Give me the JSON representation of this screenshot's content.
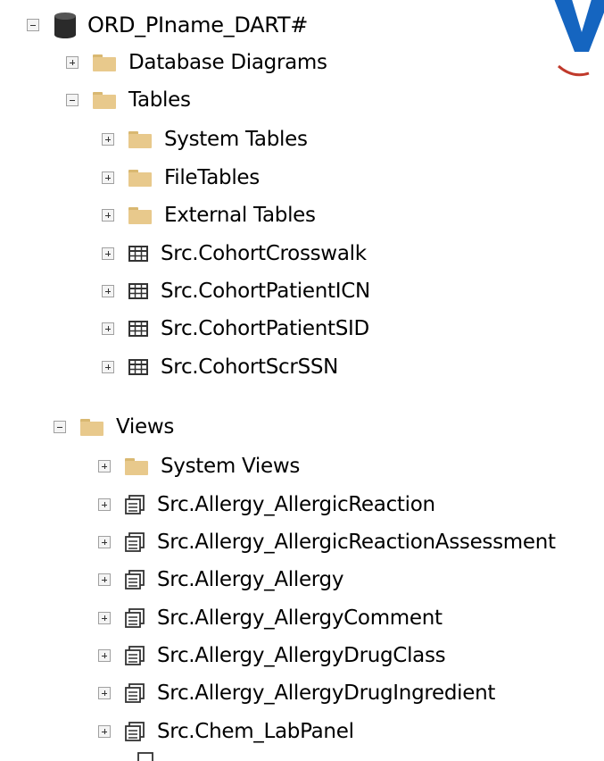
{
  "database": {
    "label": "ORD_PIname_DART#",
    "icon": "database-cylinder-icon"
  },
  "folders": {
    "database_diagrams": "Database Diagrams",
    "tables": "Tables",
    "views": "Views"
  },
  "tables": {
    "system_tables": "System Tables",
    "file_tables": "FileTables",
    "external_tables": "External Tables",
    "items": [
      "Src.CohortCrosswalk",
      "Src.CohortPatientICN",
      "Src.CohortPatientSID",
      "Src.CohortScrSSN"
    ]
  },
  "views": {
    "system_views": "System Views",
    "items": [
      "Src.Allergy_AllergicReaction",
      "Src.Allergy_AllergicReactionAssessment",
      "Src.Allergy_Allergy",
      "Src.Allergy_AllergyComment",
      "Src.Allergy_AllergyDrugClass",
      "Src.Allergy_AllergyDrugIngredient",
      "Src.Chem_LabPanel"
    ]
  },
  "colors": {
    "folder": "#e8c98c",
    "watermark_blue": "#1565c0",
    "watermark_red": "#c0392b"
  }
}
